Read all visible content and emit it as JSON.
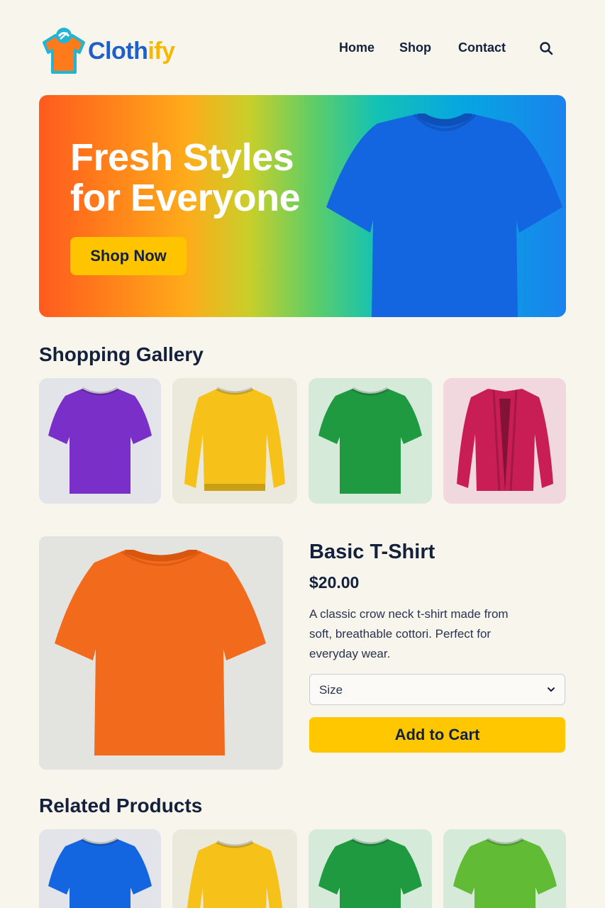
{
  "brand": {
    "name_part1": "Cloth",
    "name_part2": "ify",
    "logo_icon": "tshirt-icon"
  },
  "nav": {
    "items": [
      "Home",
      "Shop",
      "Contact"
    ],
    "search_icon": "search-icon"
  },
  "hero": {
    "title_line1": "Fresh Styles",
    "title_line2": "for Everyone",
    "cta_label": "Shop Now",
    "shirt_color": "#1466e0"
  },
  "gallery": {
    "title": "Shopping Gallery",
    "items": [
      {
        "type": "t-shirt",
        "color": "#7a2fc8",
        "bg": "#e3e4e9"
      },
      {
        "type": "sweater",
        "color": "#f6c21a",
        "bg": "#ebe8dc"
      },
      {
        "type": "t-shirt",
        "color": "#1f9a40",
        "bg": "#d5ead8"
      },
      {
        "type": "cardigan",
        "color": "#c81e55",
        "bg": "#f1d8df"
      }
    ]
  },
  "product": {
    "name": "Basic T-Shirt",
    "price": "$20.00",
    "description_lines": [
      "A classic crow neck t-shirt made from",
      "soft, breathable cottori. Perfect for",
      "everyday wear."
    ],
    "size_label": "Size",
    "add_to_cart_label": "Add to Cart",
    "shirt_color": "#f26a1b"
  },
  "related": {
    "title": "Related Products",
    "items": [
      {
        "type": "t-shirt",
        "color": "#1466e0",
        "bg": "#e3e4e9"
      },
      {
        "type": "sweater",
        "color": "#f6c21a",
        "bg": "#ebe8dc"
      },
      {
        "type": "t-shirt",
        "color": "#1f9a40",
        "bg": "#d5ead8"
      },
      {
        "type": "t-shirt",
        "color": "#62bb35",
        "bg": "#d5ead8"
      }
    ]
  },
  "colors": {
    "background": "#f8f5ec",
    "accent_yellow": "#ffc700",
    "text_navy": "#14213d",
    "brand_blue": "#1f5fc9"
  }
}
